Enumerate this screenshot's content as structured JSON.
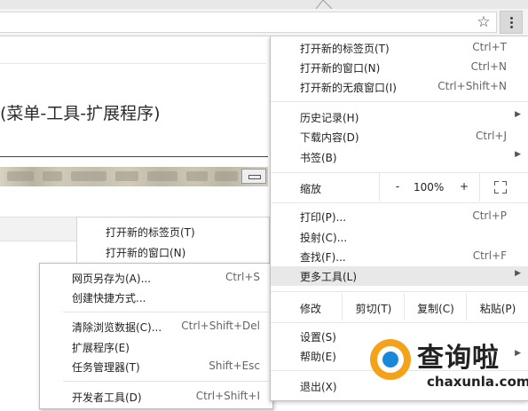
{
  "browser": {
    "star_glyph": "☆"
  },
  "page": {
    "heading": "(菜单-工具-扩展程序)"
  },
  "inner_menu": {
    "items": [
      "打开新的标签页(T)",
      "打开新的窗口(N)"
    ]
  },
  "submenu": {
    "items": [
      {
        "label": "网页另存为(A)...",
        "shortcut": "Ctrl+S"
      },
      {
        "label": "创建快捷方式...",
        "shortcut": ""
      },
      {
        "label": "清除浏览数据(C)...",
        "shortcut": "Ctrl+Shift+Del"
      },
      {
        "label": "扩展程序(E)",
        "shortcut": ""
      },
      {
        "label": "任务管理器(T)",
        "shortcut": "Shift+Esc"
      },
      {
        "label": "开发者工具(D)",
        "shortcut": "Ctrl+Shift+I"
      }
    ]
  },
  "main_menu": {
    "new_tab": {
      "label": "打开新的标签页(T)",
      "shortcut": "Ctrl+T"
    },
    "new_window": {
      "label": "打开新的窗口(N)",
      "shortcut": "Ctrl+N"
    },
    "incognito": {
      "label": "打开新的无痕窗口(I)",
      "shortcut": "Ctrl+Shift+N"
    },
    "history": {
      "label": "历史记录(H)"
    },
    "downloads": {
      "label": "下载内容(D)",
      "shortcut": "Ctrl+J"
    },
    "bookmarks": {
      "label": "书签(B)"
    },
    "zoom": {
      "label": "缩放",
      "minus": "-",
      "value": "100%",
      "plus": "+"
    },
    "print": {
      "label": "打印(P)...",
      "shortcut": "Ctrl+P"
    },
    "cast": {
      "label": "投射(C)..."
    },
    "find": {
      "label": "查找(F)...",
      "shortcut": "Ctrl+F"
    },
    "more_tools": {
      "label": "更多工具(L)"
    },
    "edit": {
      "label": "修改",
      "cut": "剪切(T)",
      "copy": "复制(C)",
      "paste": "粘贴(P)"
    },
    "settings": {
      "label": "设置(S)"
    },
    "help": {
      "label": "帮助(E)"
    },
    "exit": {
      "label": "退出(X)"
    }
  },
  "watermark": {
    "brand": "查询啦",
    "url": "chaxunla.com",
    "colors": {
      "orange": "#f4a21a",
      "blue": "#1a88d8"
    }
  }
}
